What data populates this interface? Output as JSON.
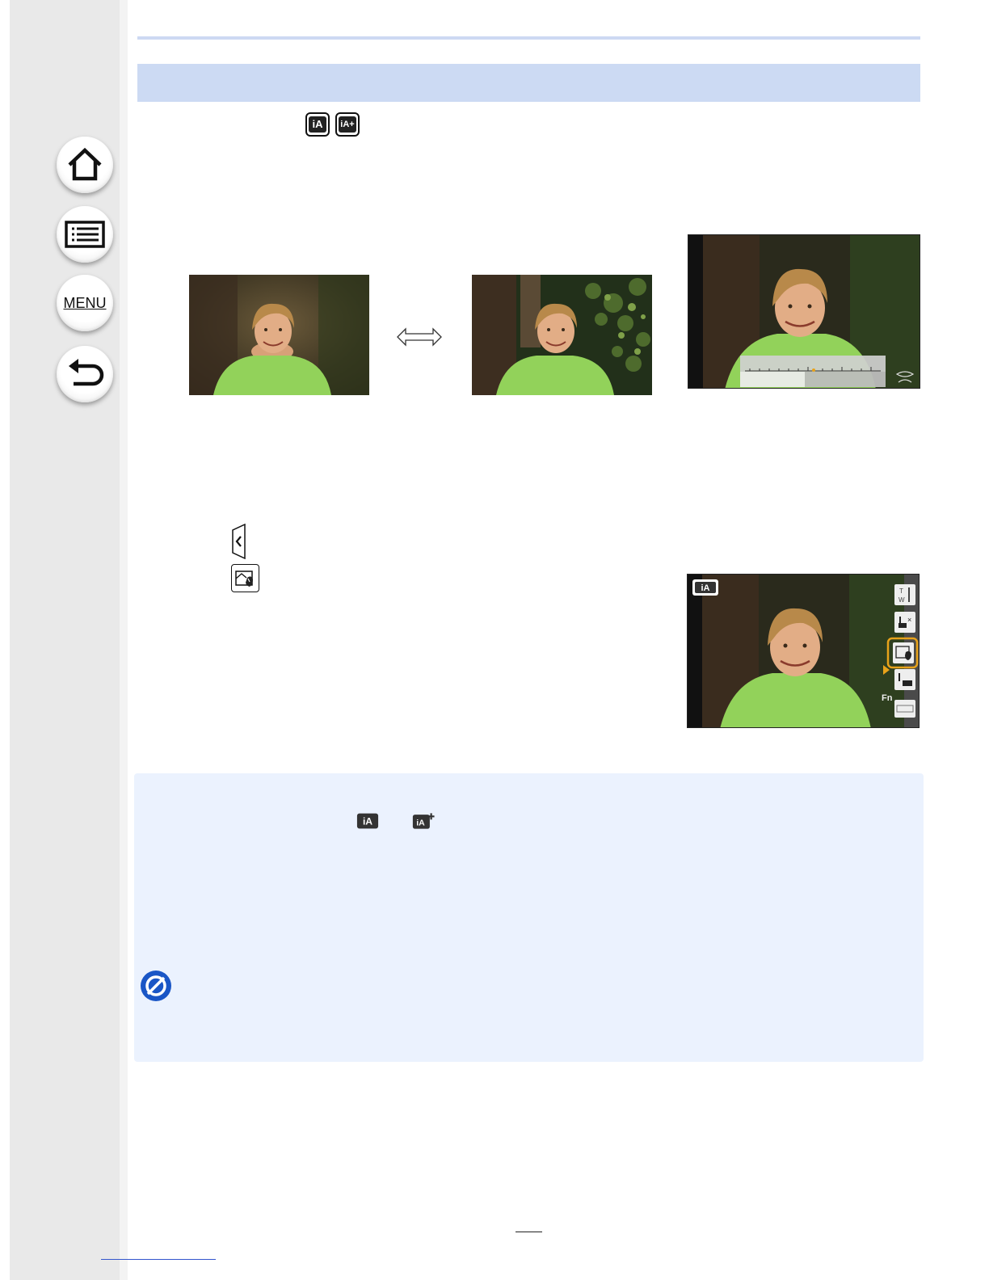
{
  "sidebar": {
    "buttons": [
      {
        "icon": "home-icon"
      },
      {
        "icon": "contents-list-icon"
      },
      {
        "icon": "menu-icon",
        "label": "MENU"
      },
      {
        "icon": "back-arrow-icon"
      }
    ]
  },
  "section_header": {
    "mode_icons": [
      "iA",
      "iA+"
    ]
  },
  "figures": {
    "comparison": {
      "left_photo": "blurred-background-photo",
      "right_photo": "sharp-background-photo",
      "connector": "double-arrow-icon"
    },
    "slider_screen": {
      "icon": "defocus-slider-icon"
    },
    "touch_screen": {
      "mode_badge": "iA",
      "side_icons": [
        "zoom-tw-icon",
        "touch-shutter-off-icon",
        "defocus-control-icon",
        "touch-ae-icon",
        "peaking-icon"
      ],
      "side_labels": {
        "fn": "Fn"
      }
    }
  },
  "steps": {
    "tab_icon": "chevron-left-tab-icon",
    "control_icon": "defocus-control-icon"
  },
  "note": {
    "mode_icons": [
      "iA",
      "iA+"
    ],
    "prohibit_icon": "not-available-icon"
  },
  "colors": {
    "accent_band": "#ccdaf3",
    "note_bg": "#ebf2fe",
    "prohibit_blue": "#1a56c6",
    "highlight_orange": "#e8a21a"
  }
}
